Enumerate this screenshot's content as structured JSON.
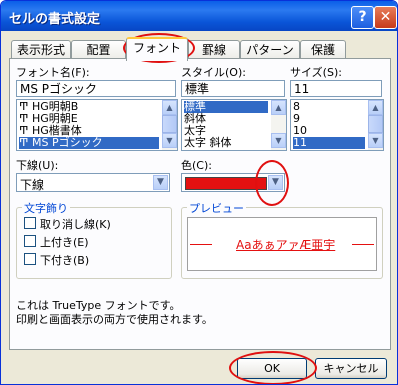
{
  "window": {
    "title": "セルの書式設定",
    "help_label": "?",
    "close_label": "✕"
  },
  "tabs": [
    {
      "label": "表示形式"
    },
    {
      "label": "配置"
    },
    {
      "label": "フォント"
    },
    {
      "label": "罫線"
    },
    {
      "label": "パターン"
    },
    {
      "label": "保護"
    }
  ],
  "font_name": {
    "label": "フォント名(F):",
    "value": "MS Pゴシック",
    "items": [
      "HG明朝B",
      "HG明朝E",
      "HG楷書体",
      "MS Pゴシック"
    ],
    "item_icon": "truetype-icon"
  },
  "font_style": {
    "label": "スタイル(O):",
    "value": "標準",
    "items": [
      "標準",
      "斜体",
      "太字",
      "太字 斜体"
    ]
  },
  "font_size": {
    "label": "サイズ(S):",
    "value": "11",
    "items": [
      "8",
      "9",
      "10",
      "11"
    ]
  },
  "underline": {
    "label": "下線(U):",
    "value": "下線"
  },
  "color": {
    "label": "色(C):",
    "swatch": "#e41111"
  },
  "effects": {
    "title": "文字飾り",
    "strikethrough": "取り消し線(K)",
    "superscript": "上付き(E)",
    "subscript": "下付き(B)"
  },
  "preview": {
    "title": "プレビュー",
    "sample": "AaあぁアァÆ亜宇",
    "sample_color": "#e41111"
  },
  "description": {
    "line1": "これは TrueType フォントです。",
    "line2": "印刷と画面表示の両方で使用されます。"
  },
  "buttons": {
    "ok": "OK",
    "cancel": "キャンセル"
  },
  "annotation_color": "#e01010"
}
